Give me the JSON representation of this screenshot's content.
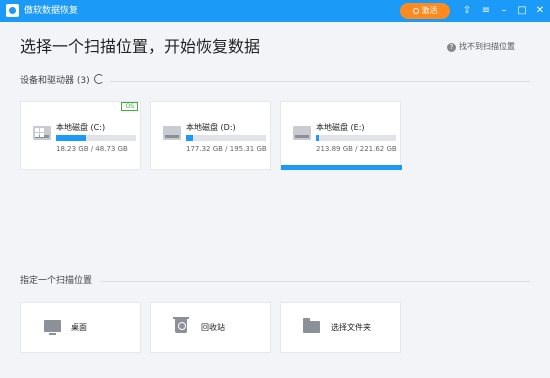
{
  "window": {
    "title": "傲软数据恢复",
    "upgrade_label": "激活",
    "icons": [
      "import-icon",
      "menu-icon",
      "minimize-icon",
      "maximize-icon",
      "close-icon"
    ]
  },
  "main": {
    "heading": "选择一个扫描位置，开始恢复数据",
    "help_link": "找不到扫描位置"
  },
  "devices": {
    "section_label": "设备和驱动器 (3)",
    "drives": [
      {
        "name": "本地磁盘 (C:)",
        "size": "18.23 GB / 48.73 GB",
        "used_fraction": 0.374,
        "badge": "OS",
        "icon": "windows-drive-icon"
      },
      {
        "name": "本地磁盘 (D:)",
        "size": "177.32 GB / 195.31 GB",
        "used_fraction": 0.09,
        "icon": "drive-icon"
      },
      {
        "name": "本地磁盘 (E:)",
        "size": "213.89 GB / 221.62 GB",
        "used_fraction": 0.035,
        "icon": "drive-icon"
      }
    ]
  },
  "locations": {
    "section_label": "指定一个扫描位置",
    "items": [
      {
        "label": "桌面",
        "icon": "desktop-icon"
      },
      {
        "label": "回收站",
        "icon": "recycle-bin-icon"
      },
      {
        "label": "选择文件夹",
        "icon": "folder-icon"
      }
    ]
  },
  "colors": {
    "accent": "#1b9af7",
    "upgrade": "#ff8a1f",
    "os_badge": "#3cae3c"
  }
}
